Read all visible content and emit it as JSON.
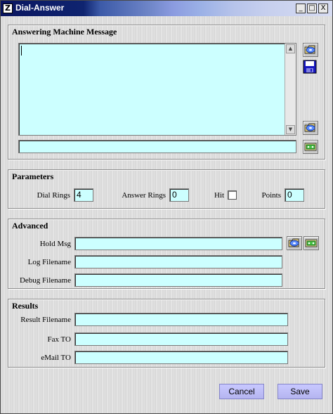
{
  "window": {
    "title": "Dial-Answer",
    "app_icon": "Z",
    "min": "_",
    "max": "□",
    "close": "X"
  },
  "answering": {
    "title": "Answering Machine Message",
    "message_text": "",
    "path_value": "",
    "icons": [
      "open-icon",
      "save-icon",
      "open-icon",
      "play-icon"
    ]
  },
  "parameters": {
    "title": "Parameters",
    "dial_rings_label": "Dial Rings",
    "dial_rings_value": "4",
    "answer_rings_label": "Answer Rings",
    "answer_rings_value": "0",
    "hit_label": "Hit",
    "hit_checked": false,
    "points_label": "Points",
    "points_value": "0"
  },
  "advanced": {
    "title": "Advanced",
    "hold_msg_label": "Hold Msg",
    "hold_msg_value": "",
    "log_filename_label": "Log Filename",
    "log_filename_value": "",
    "debug_filename_label": "Debug Filename",
    "debug_filename_value": ""
  },
  "results": {
    "title": "Results",
    "result_filename_label": "Result Filename",
    "result_filename_value": "",
    "fax_to_label": "Fax TO",
    "fax_to_value": "",
    "email_to_label": "eMail TO",
    "email_to_value": ""
  },
  "buttons": {
    "cancel": "Cancel",
    "save": "Save"
  },
  "colors": {
    "field": "#ccffff",
    "button": "#c0c0f8",
    "title_dark": "#0a1560",
    "title_light": "#d7dcf2"
  }
}
